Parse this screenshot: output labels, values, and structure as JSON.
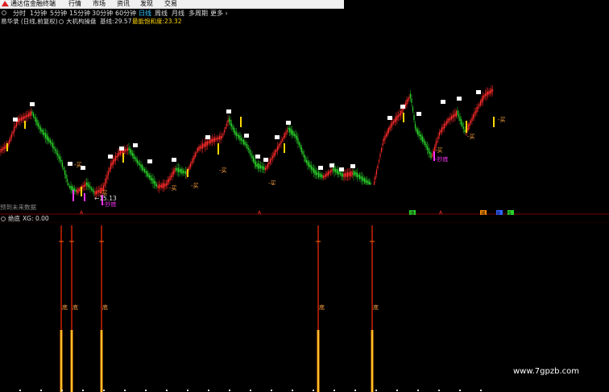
{
  "app": {
    "title": "通达信金融终端"
  },
  "menu": [
    "行情",
    "市场",
    "资讯",
    "发现",
    "交易"
  ],
  "periods": [
    "分时",
    "1分钟",
    "5分钟",
    "15分钟",
    "30分钟",
    "60分钟",
    "日线",
    "周线",
    "月线",
    "多周期",
    "更多 ›"
  ],
  "active_period": "日线",
  "main_chart": {
    "name": "易华录 (日线,前复权)",
    "indicator": "大机构操盘",
    "baseline_label": "基线:",
    "baseline_value": "29.57",
    "energy_label": "最能饱和度:",
    "energy_value": "23.32",
    "low_price": "15.13",
    "future_label": "预到未来数据"
  },
  "signals": {
    "buy": "买",
    "sell": "卖",
    "bottom": "抄底",
    "b": "B",
    "s": "S",
    "marker_a": "A",
    "zhang": "涨",
    "jian": "减"
  },
  "sub_chart": {
    "name": "绝底",
    "xg_label": "XG:",
    "xg_value": "0.00",
    "bar_label": "底"
  },
  "colors": {
    "up": "#ff2a2a",
    "down": "#2ad12a",
    "accent": "#39c8ff",
    "yellow": "#ffd800",
    "magenta": "#ff33ff",
    "orange": "#ff8c00"
  },
  "watermark": "www.7gpzb.com"
}
